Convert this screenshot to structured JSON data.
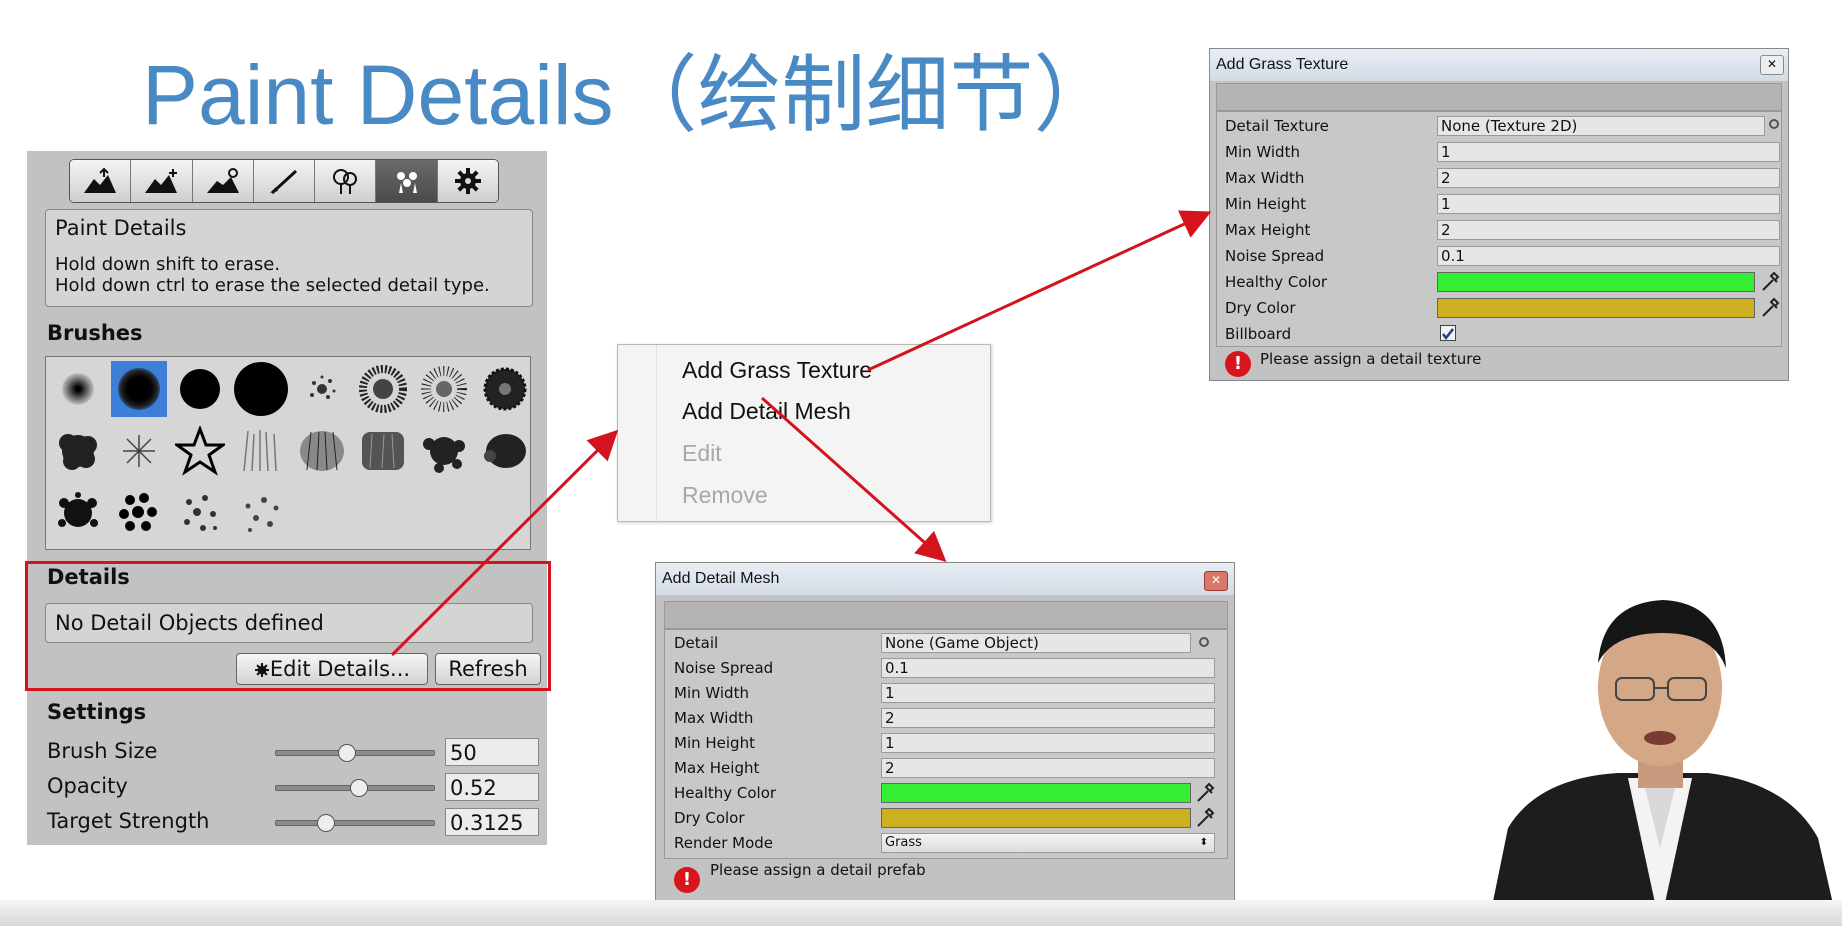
{
  "slide": {
    "title": "Paint Details（绘制细节）"
  },
  "toolbar": {
    "tools": [
      {
        "icon": "raise-terrain-icon"
      },
      {
        "icon": "paint-height-icon"
      },
      {
        "icon": "smooth-height-icon"
      },
      {
        "icon": "paint-texture-icon"
      },
      {
        "icon": "place-trees-icon"
      },
      {
        "icon": "paint-details-icon",
        "active": true
      },
      {
        "icon": "terrain-settings-icon"
      }
    ]
  },
  "panel": {
    "help_title": "Paint Details",
    "help_line1": "Hold down shift to erase.",
    "help_line2": "Hold down ctrl to erase the selected detail type.",
    "brushes_label": "Brushes",
    "details_label": "Details",
    "details_empty": "No Detail Objects defined",
    "edit_details_label": "Edit Details...",
    "refresh_label": "Refresh",
    "settings_label": "Settings",
    "settings": [
      {
        "label": "Brush Size",
        "value": "50",
        "level": 0.44
      },
      {
        "label": "Opacity",
        "value": "0.52",
        "level": 0.52
      },
      {
        "label": "Target Strength",
        "value": "0.3125",
        "level": 0.31
      }
    ]
  },
  "context_menu": {
    "items": [
      {
        "label": "Add Grass Texture",
        "enabled": true
      },
      {
        "label": "Add Detail Mesh",
        "enabled": true
      },
      {
        "label": "Edit",
        "enabled": false
      },
      {
        "label": "Remove",
        "enabled": false
      }
    ]
  },
  "grass_dialog": {
    "title": "Add Grass Texture",
    "rows": [
      {
        "label": "Detail Texture",
        "value": "None (Texture 2D)"
      },
      {
        "label": "Min Width",
        "value": "1"
      },
      {
        "label": "Max Width",
        "value": "2"
      },
      {
        "label": "Min Height",
        "value": "1"
      },
      {
        "label": "Max Height",
        "value": "2"
      },
      {
        "label": "Noise Spread",
        "value": "0.1"
      }
    ],
    "healthy_color_label": "Healthy Color",
    "dry_color_label": "Dry Color",
    "billboard_label": "Billboard",
    "billboard_checked": true,
    "healthy_color": "#33ee33",
    "dry_color": "#ccb020",
    "error": "Please assign a detail texture"
  },
  "mesh_dialog": {
    "title": "Add Detail Mesh",
    "rows": [
      {
        "label": "Detail",
        "value": "None (Game Object)"
      },
      {
        "label": "Noise Spread",
        "value": "0.1"
      },
      {
        "label": "Min Width",
        "value": "1"
      },
      {
        "label": "Max Width",
        "value": "2"
      },
      {
        "label": "Min Height",
        "value": "1"
      },
      {
        "label": "Max Height",
        "value": "2"
      }
    ],
    "healthy_color_label": "Healthy Color",
    "dry_color_label": "Dry Color",
    "render_mode_label": "Render Mode",
    "render_mode_value": "Grass",
    "healthy_color": "#33ee33",
    "dry_color": "#ccb020",
    "error": "Please assign a detail prefab"
  },
  "colors": {
    "accent_title": "#4a8ac4",
    "highlight_red": "#d4141c",
    "selected_brush": "#3d7fd6"
  }
}
